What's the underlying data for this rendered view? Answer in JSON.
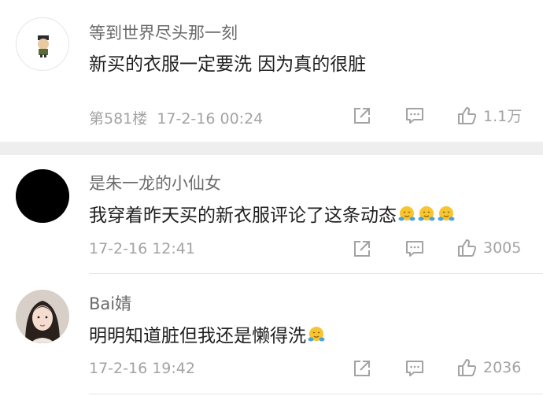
{
  "comments": [
    {
      "username": "等到世界尽头那一刻",
      "text": "新买的衣服一定要洗 因为真的很脏",
      "emoji_count": 0,
      "floor": "第581楼",
      "timestamp": "17-2-16 00:24",
      "like_count": "1.1万",
      "avatar_icon": "cartoon-character-avatar"
    },
    {
      "username": "是朱一龙的小仙女",
      "text": "我穿着昨天买的新衣服评论了这条动态",
      "emoji_count": 3,
      "floor": "",
      "timestamp": "17-2-16 12:41",
      "like_count": "3005",
      "avatar_icon": "black-circle-avatar"
    },
    {
      "username": "Bai婧",
      "text": "明明知道脏但我还是懒得洗",
      "emoji_count": 1,
      "floor": "",
      "timestamp": "17-2-16 19:42",
      "like_count": "2036",
      "avatar_icon": "girl-photo-avatar"
    }
  ],
  "icons": {
    "share": "share-icon",
    "comment": "comment-icon",
    "like": "thumbs-up-icon",
    "emoji": "hug-emoji"
  },
  "colors": {
    "meta_text": "#a3a3a3",
    "username": "#6b6b6b",
    "section_divider": "#eeeeee"
  }
}
